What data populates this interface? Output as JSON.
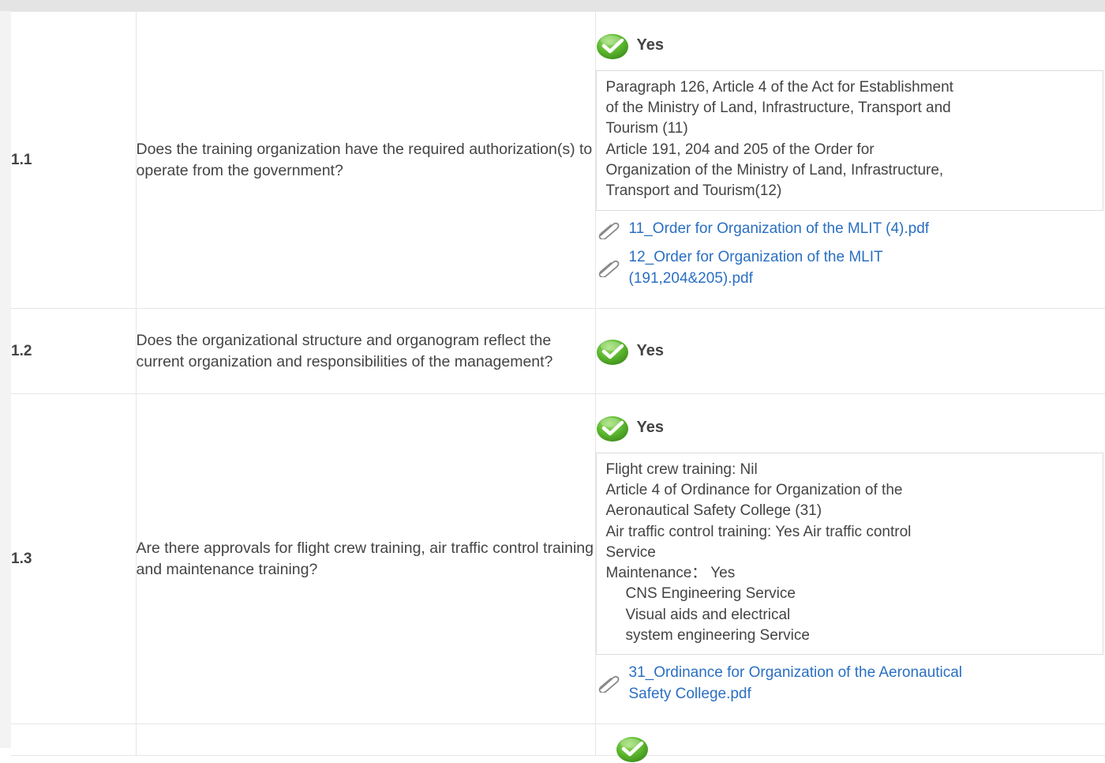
{
  "rows": [
    {
      "number": "1.1",
      "question": "Does the training organization have the required authorization(s) to operate from the government?",
      "answer": "Yes",
      "evidence_lines": [
        "Paragraph 126, Article 4 of the Act for Establishment",
        "of the Ministry of Land, Infrastructure, Transport and",
        "Tourism (11)",
        "Article 191, 204 and 205 of the Order for",
        "Organization of the Ministry of Land, Infrastructure,",
        "Transport and Tourism(12)"
      ],
      "attachments": [
        [
          "11_Order for Organization of the MLIT (4).pdf"
        ],
        [
          "12_Order for Organization of the MLIT",
          "(191,204&205).pdf"
        ]
      ]
    },
    {
      "number": "1.2",
      "question": "Does the organizational structure and organogram reflect the current organization and responsibilities of the management?",
      "answer": "Yes"
    },
    {
      "number": "1.3",
      "question": "Are there approvals for flight crew training, air traffic control training and maintenance training?",
      "answer": "Yes",
      "evidence_lines": [
        "Flight crew training: Nil",
        "Article 4 of Ordinance for Organization of the",
        "Aeronautical Safety College (31)",
        "Air traffic control training: Yes Air traffic control",
        "Service",
        "Maintenance： Yes",
        "CNS Engineering Service",
        "Visual aids and electrical",
        "system engineering Service"
      ],
      "attachments": [
        [
          "31_Ordinance for Organization of the Aeronautical",
          "Safety College.pdf"
        ]
      ]
    }
  ],
  "icons": {
    "answer_icon": "green-check-circle-icon",
    "attachment_icon": "paperclip-icon"
  },
  "colors": {
    "check_green": "#5cb82e",
    "link_blue": "#2a6fc2",
    "border": "#e6e6e6"
  }
}
